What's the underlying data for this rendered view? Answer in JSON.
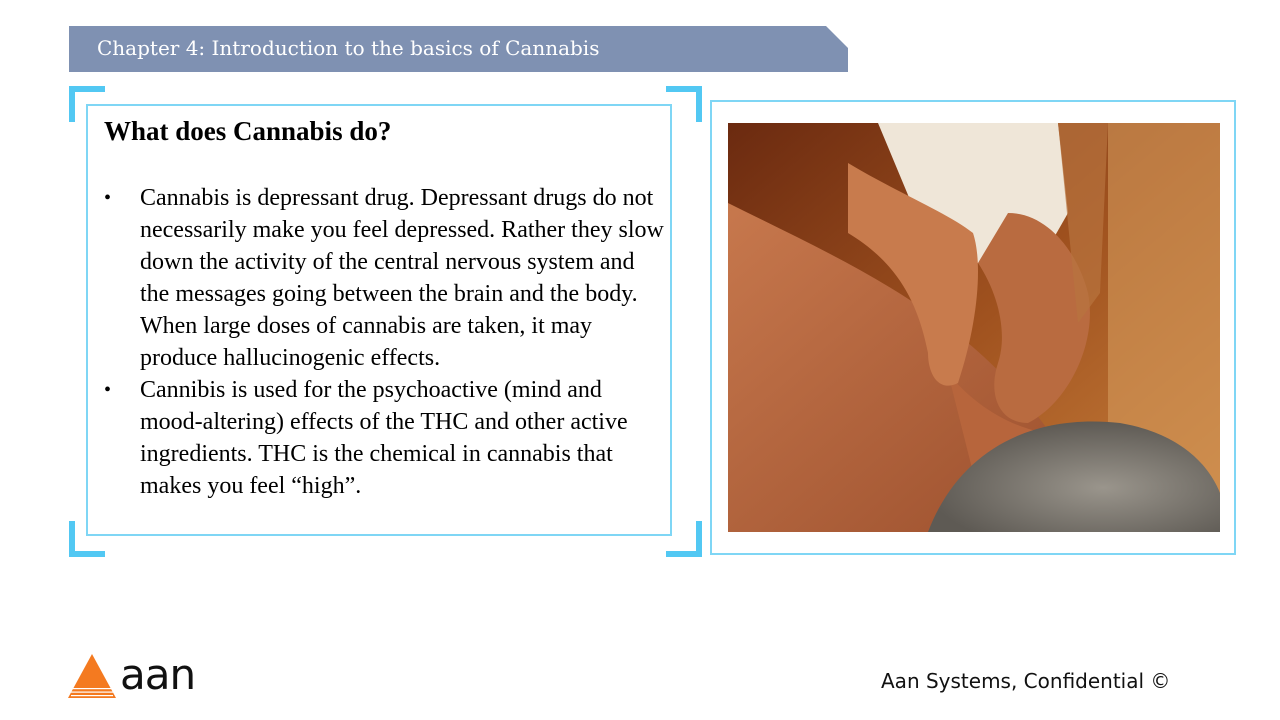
{
  "banner": {
    "title": "Chapter 4: Introduction to the basics of Cannabis"
  },
  "content": {
    "heading": "What does Cannabis do?",
    "bullets": [
      "Cannabis is depressant drug.  Depressant drugs do not necessarily make you feel depressed.  Rather they slow down the activity of the central nervous system and the messages going between the brain and the body.  When large doses of cannabis are taken, it may produce hallucinogenic effects.",
      "Cannibis is used for the psychoactive (mind and mood-altering) effects of the THC and other active ingredients.  THC is the chemical in cannabis that makes you feel “high”."
    ]
  },
  "footer": {
    "logo_text": "aan",
    "confidential": "Aan Systems, Confidential ©"
  },
  "colors": {
    "banner": "#7f91b2",
    "frame": "#52c8f3",
    "logo": "#f47a20"
  },
  "icons": {
    "bullet": "•"
  }
}
